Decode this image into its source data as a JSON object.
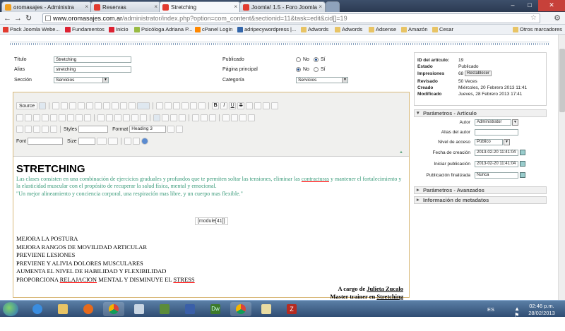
{
  "browser": {
    "tabs": [
      {
        "label": "oromasajes - Administra",
        "color": "#f0a020",
        "active": false
      },
      {
        "label": "Reservas",
        "color": "#e23b2f",
        "active": false
      },
      {
        "label": "Stretching",
        "color": "#e23b2f",
        "active": true
      },
      {
        "label": "Joomla! 1.5 - Foro Joomla",
        "color": "#e23b2f",
        "active": false
      }
    ],
    "url_host": "www.oromasajes.com.ar",
    "url_path": "/administrator/index.php?option=com_content&sectionid=11&task=edit&cid[]=19",
    "bookmarks": [
      "Pack Joomla Webe...",
      "Fundamentos",
      "Inicio",
      "Psicóloga Adriana P...",
      "cPanel Login",
      "adripecywordpress |...",
      "Adwords",
      "Adwords",
      "Adsense",
      "Amazón",
      "Cesar",
      "Otros marcadores"
    ]
  },
  "form": {
    "titulo_label": "Título",
    "titulo_value": "Stretching",
    "alias_label": "Alias",
    "alias_value": "stretching",
    "seccion_label": "Sección",
    "seccion_value": "Servicios",
    "publicado_label": "Publicado",
    "pagina_label": "Página principal",
    "categoria_label": "Categoría",
    "categoria_value": "Servicios",
    "no_label": "No",
    "si_label": "Sí"
  },
  "editor": {
    "source_label": "Source",
    "styles_label": "Styles",
    "format_label": "Format",
    "format_value": "Heading 3",
    "font_label": "Font",
    "size_label": "Size"
  },
  "article": {
    "heading": "STRETCHING",
    "para1_part1": "Las clases consisten en una combinación de ejercicios graduales y profundos que te permiten soltar las tensiones, eliminar las ",
    "para1_underlined": "contracturas",
    "para1_part2": " y mantener el fortalecimiento y la elasticidad muscular con el propósito de recuperar la salud física, mental y emocional.",
    "para2": "\"Un mejor alineamiento y conciencia corporal, una respiración mas libre, y un cuerpo mas flexible.\"",
    "module": "[module[41]]",
    "list": [
      "MEJORA LA POSTURA",
      "MEJORA RANGOS DE MOVILIDAD ARTICULAR",
      "PREVIENE LESIONES",
      "PREVIENE Y ALIVIA DOLORES MUSCULARES",
      "AUMENTA EL NIVEL DE HABILIDAD Y FLEXIBILIDAD"
    ],
    "last_part1": "PROPORCIONA ",
    "last_underlined1": "RELAJACION",
    "last_part2": " MENTAL Y DISMINUYE EL ",
    "last_underlined2": "STRESS",
    "sig1_prefix": "A cargo de ",
    "sig1_name": "Julieta Zucalo",
    "sig2_prefix": "Master trainer en ",
    "sig2_name": "Stretching"
  },
  "info": {
    "id_label": "ID del artículo:",
    "id_value": "19",
    "estado_label": "Estado",
    "estado_value": "Publicado",
    "impresiones_label": "Impresiones",
    "impresiones_value": "68",
    "restablecer_label": "Restablecer",
    "revisado_label": "Revisado",
    "revisado_value": "50 Veces",
    "creado_label": "Creado",
    "creado_value": "Miércoles, 20 Febrero 2013 11:41",
    "modificado_label": "Modificado",
    "modificado_value": "Jueves, 28 Febrero 2013 17:41"
  },
  "params": {
    "header": "Parámetros - Artículo",
    "autor_label": "Autor",
    "autor_value": "Administrator",
    "alias_autor_label": "Alias del autor",
    "nivel_label": "Nivel de acceso",
    "nivel_value": "Público",
    "fecha_creacion_label": "Fecha de creación",
    "fecha_creacion_value": "2013-02-20 11:41:04",
    "inicio_label": "Iniciar publicación",
    "inicio_value": "2013-02-20 11:41:04",
    "fin_label": "Publicación finalizada",
    "fin_value": "Nunca",
    "avanzados_header": "Parámetros - Avanzados",
    "metadatos_header": "Información de metadatos"
  },
  "taskbar": {
    "lang": "ES",
    "time": "02:46 p.m.",
    "date": "28/02/2013"
  }
}
